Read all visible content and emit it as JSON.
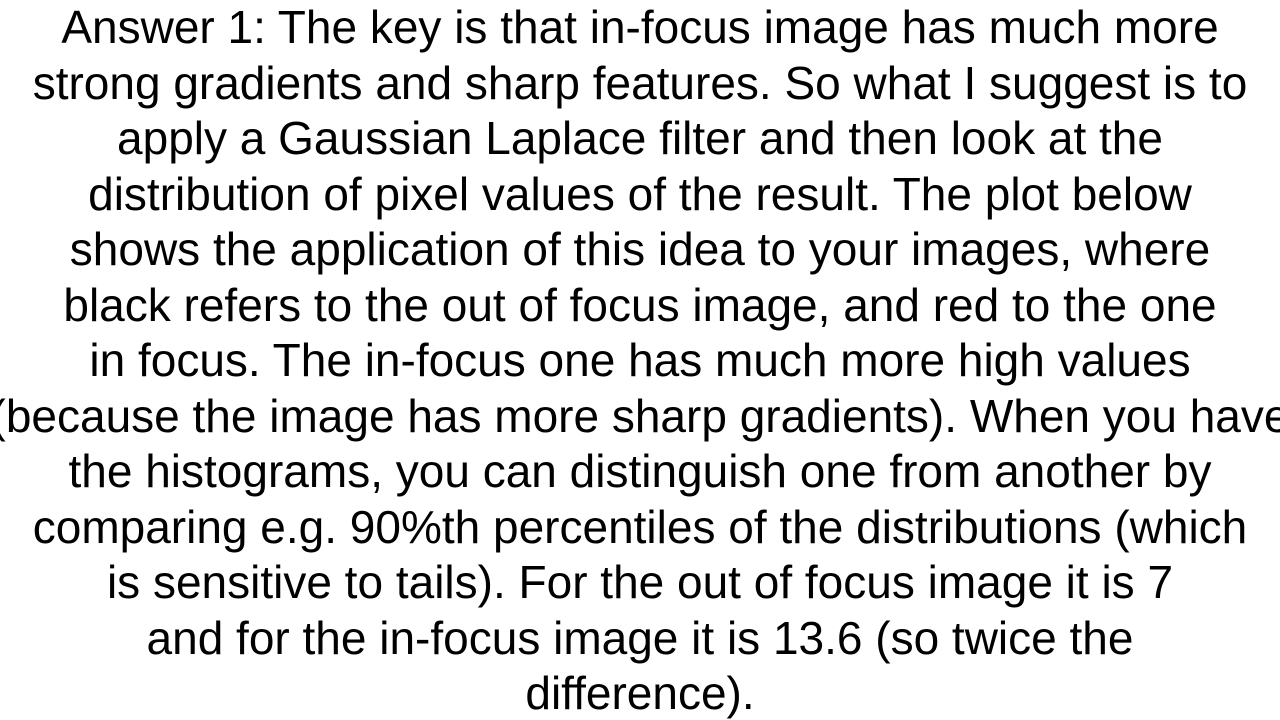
{
  "document": {
    "lines": [
      "Answer 1: The key is that in-focus image has much more",
      "strong gradients and sharp features. So what I suggest is to",
      "apply a Gaussian Laplace filter and then look at the",
      "distribution of pixel values of the result. The plot below",
      "shows the application of this idea to your images, where",
      "black refers to the out of focus image, and red to the one",
      "in focus. The in-focus one has much more high values",
      "(because the image has more sharp gradients). When you have",
      "the histograms, you can distinguish one from another by",
      "comparing e.g. 90%th percentiles of the distributions (which",
      "is sensitive to tails).  For the out of focus image it is 7",
      "and for the in-focus image it is 13.6 (so twice the",
      "difference)."
    ]
  }
}
